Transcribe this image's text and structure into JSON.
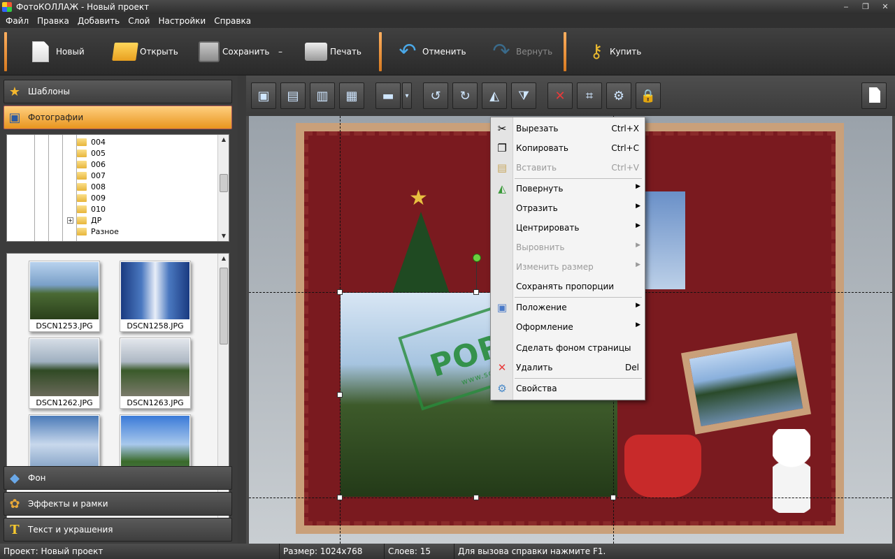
{
  "window": {
    "title": "ФотоКОЛЛАЖ - Новый проект",
    "controls": [
      "‒",
      "❐",
      "✕"
    ]
  },
  "menu": [
    "Файл",
    "Правка",
    "Добавить",
    "Слой",
    "Настройки",
    "Справка"
  ],
  "toolbar": {
    "new": "Новый",
    "open": "Открыть",
    "save": "Сохранить",
    "save_more": "–",
    "print": "Печать",
    "undo": "Отменить",
    "redo": "Вернуть",
    "buy": "Купить"
  },
  "panels": {
    "templates": "Шаблоны",
    "photos": "Фотографии",
    "background": "Фон",
    "effects": "Эффекты и рамки",
    "text": "Текст и украшения"
  },
  "tree": [
    "004",
    "005",
    "006",
    "007",
    "008",
    "009",
    "010",
    "ДР",
    "Разное"
  ],
  "thumbnails": [
    "DSCN1253.JPG",
    "DSCN1258.JPG",
    "DSCN1262.JPG",
    "DSCN1263.JPG",
    "",
    ""
  ],
  "context_menu": {
    "cut": "Вырезать",
    "cut_sc": "Ctrl+X",
    "copy": "Копировать",
    "copy_sc": "Ctrl+C",
    "paste": "Вставить",
    "paste_sc": "Ctrl+V",
    "rotate": "Повернуть",
    "flip": "Отразить",
    "center": "Центрировать",
    "align": "Выровнить",
    "resize": "Изменить размер",
    "keep_prop": "Сохранять пропорции",
    "position": "Положение",
    "design": "Оформление",
    "make_bg": "Сделать фоном страницы",
    "delete": "Удалить",
    "delete_sc": "Del",
    "properties": "Свойства"
  },
  "watermark": {
    "text": "PORTAL",
    "sub": "www.softportal.com",
    "tm": "™"
  },
  "status": {
    "project": "Проект: Новый проект",
    "size": "Размер: 1024x768",
    "layers": "Слоев: 15",
    "hint": "Для вызова справки нажмите F1."
  },
  "colors": {
    "accent": "#e8951e",
    "canvas_bg": "#7a1a1f",
    "frame": "#c9a07a"
  }
}
